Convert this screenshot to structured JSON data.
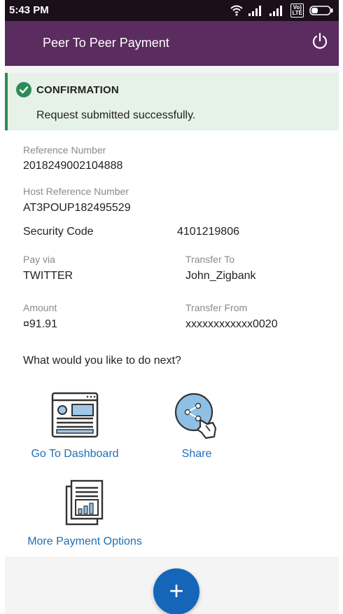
{
  "status_bar": {
    "time": "5:43 PM",
    "volte": "Vo)\nLTE"
  },
  "header": {
    "title": "Peer To Peer Payment"
  },
  "confirmation": {
    "title": "CONFIRMATION",
    "message": "Request submitted successfully."
  },
  "details": {
    "reference_label": "Reference Number",
    "reference_value": "2018249002104888",
    "host_reference_label": "Host Reference Number",
    "host_reference_value": "AT3POUP182495529",
    "security_code_label": "Security Code",
    "security_code_value": "4101219806",
    "pay_via_label": "Pay via",
    "pay_via_value": "TWITTER",
    "transfer_to_label": "Transfer To",
    "transfer_to_value": "John_Zigbank",
    "amount_label": "Amount",
    "amount_value": "¤91.91",
    "transfer_from_label": "Transfer From",
    "transfer_from_value": "xxxxxxxxxxxx0020"
  },
  "next_steps": {
    "title": "What would you like to do next?",
    "actions": [
      {
        "label": "Go To Dashboard",
        "icon": "dashboard-icon"
      },
      {
        "label": "Share",
        "icon": "share-icon"
      },
      {
        "label": "More Payment Options",
        "icon": "payment-options-icon"
      }
    ]
  },
  "fab": {
    "label": "+"
  },
  "colors": {
    "header": "#5b2c5f",
    "status_bar": "#1a0f1a",
    "confirm_bg": "#e6f1e7",
    "success": "#2e8b57",
    "link": "#1f6fb5",
    "fab": "#1565b8"
  }
}
